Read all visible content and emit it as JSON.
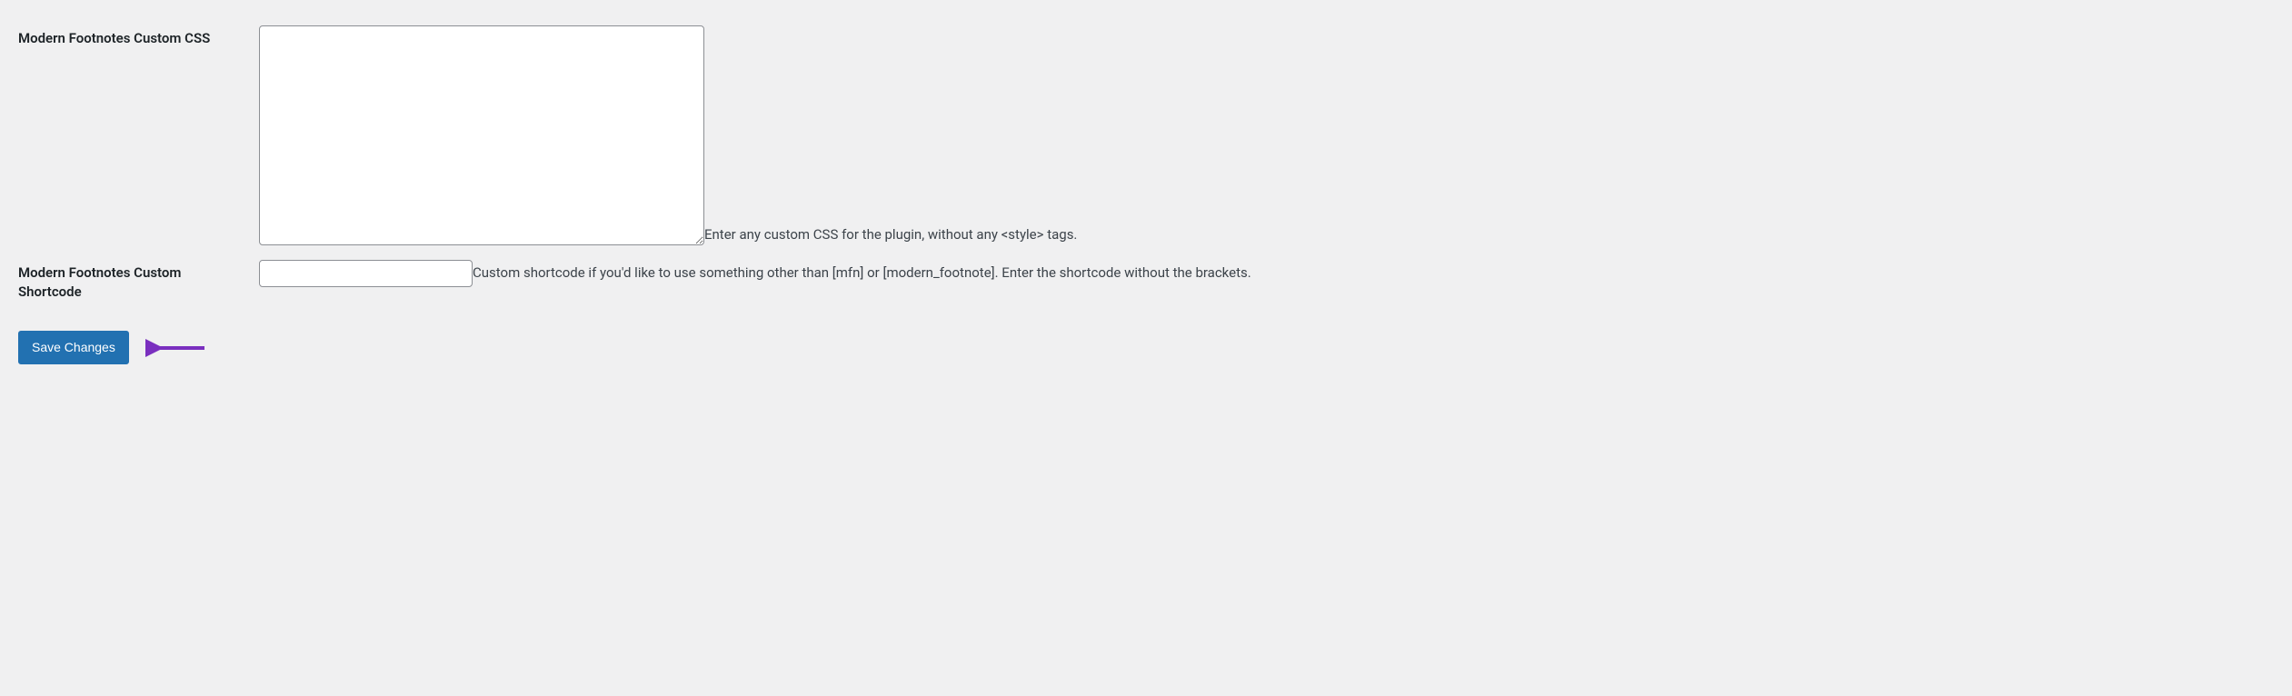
{
  "settings": {
    "customCss": {
      "label": "Modern Footnotes Custom CSS",
      "value": "",
      "description": "Enter any custom CSS for the plugin, without any <style> tags."
    },
    "customShortcode": {
      "label": "Modern Footnotes Custom Shortcode",
      "value": "",
      "description": "Custom shortcode if you'd like to use something other than [mfn] or [modern_footnote]. Enter the shortcode without the brackets."
    }
  },
  "submit": {
    "label": "Save Changes"
  }
}
